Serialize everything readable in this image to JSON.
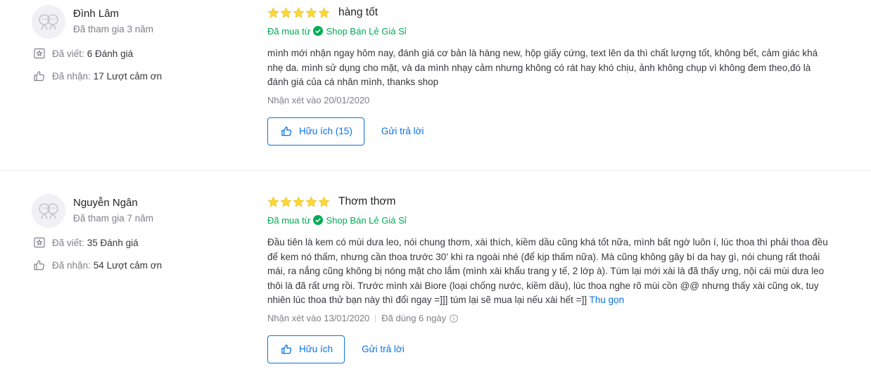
{
  "colors": {
    "accent": "#0b74e5",
    "star": "#fdd836",
    "verified": "#00ab56",
    "muted": "#808089"
  },
  "reviews": [
    {
      "user": {
        "name": "Đình Lâm",
        "joined": "Đã tham gia 3 năm",
        "avatar_icon": "default-avatar-icon"
      },
      "stats": {
        "written_label": "Đã viết:",
        "written_value": "6 Đánh giá",
        "received_label": "Đã nhận:",
        "received_value": "17 Lượt cảm ơn"
      },
      "rating": 5,
      "title": "hàng tốt",
      "purchase": {
        "label": "Đã mua từ",
        "shop": "Shop Bán Lẻ Giá Sỉ"
      },
      "content": "mình mới nhận ngay hôm nay, đánh giá cơ bản là hàng new, hộp giấy cứng, text lên da thì chất lượng tốt, không bết, cảm giác khá nhẹ da. mình sử dụng cho mặt, và da mình nhạy cảm nhưng không có rát hay khó chịu, ảnh không chụp vì không đem theo,đó là đánh giá của cá nhân mình, thanks shop",
      "reviewed_at": "Nhận xét vào 20/01/2020",
      "helpful_label": "Hữu ích (15)",
      "reply_label": "Gửi trả lời"
    },
    {
      "user": {
        "name": "Nguyễn Ngân",
        "joined": "Đã tham gia 7 năm",
        "avatar_icon": "default-avatar-icon"
      },
      "stats": {
        "written_label": "Đã viết:",
        "written_value": "35 Đánh giá",
        "received_label": "Đã nhận:",
        "received_value": "54 Lượt cảm ơn"
      },
      "rating": 5,
      "title": "Thơm thơm",
      "purchase": {
        "label": "Đã mua từ",
        "shop": "Shop Bán Lẻ Giá Sỉ"
      },
      "content": "Đầu tiên là kem có mùi dưa leo, nói chung thơm, xài thích, kiềm dầu cũng khá tốt nữa, mình bất ngờ luôn í, lúc thoa thì phải thoa đều để kem nó thấm, nhưng cần thoa trước 30' khi ra ngoài nhé (để kịp thấm nữa). Mà cũng không gây bí da hay gì, nói chung rất thoải mái, ra nắng cũng không bị nóng mặt cho lắm (mình xài khẩu trang y tế, 2 lớp à). Túm lại mới xài là đã thấy ưng, nội cái mùi dưa leo thôi là đã rất ưng rồi. Trước mình xài Biore (loại chống nước, kiềm dầu), lúc thoa nghe rõ mùi cồn @@ nhưng thấy xài cũng ok, tuy nhiên lúc thoa thử bạn này thì đổi ngay =]]] túm lại sẽ mua lại nếu xài hết =]]",
      "collapse_label": "Thu gọn",
      "reviewed_at": "Nhận xét vào 13/01/2020",
      "used_for": "Đã dùng 6 ngày",
      "helpful_label": "Hữu ích",
      "reply_label": "Gửi trả lời"
    }
  ]
}
